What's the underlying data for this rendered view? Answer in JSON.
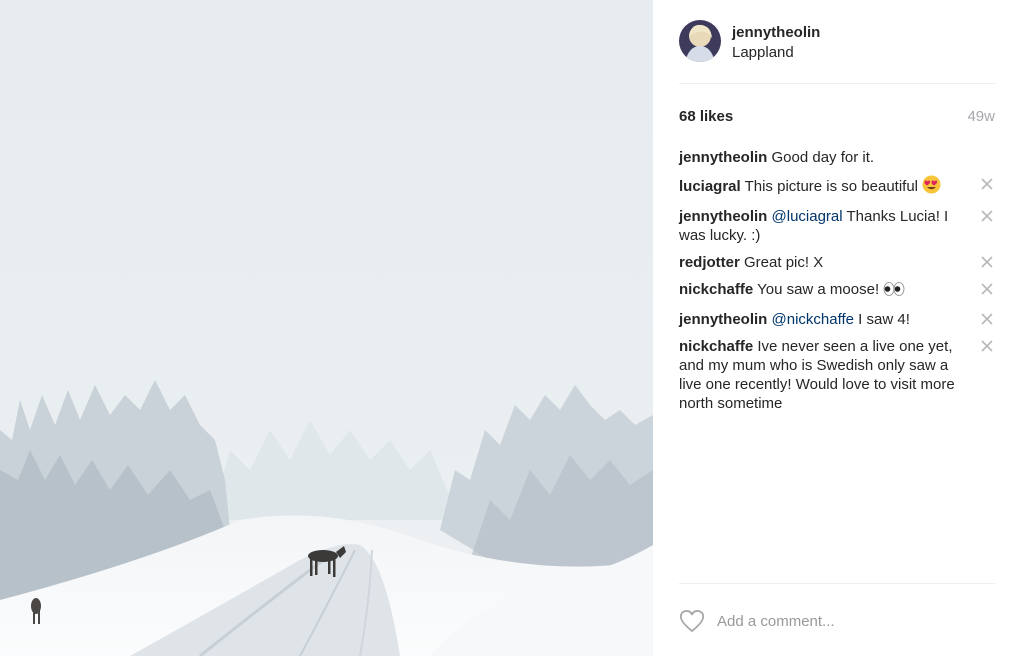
{
  "post": {
    "username": "jennytheolin",
    "location": "Lappland",
    "likes": "68 likes",
    "age": "49w"
  },
  "comments": [
    {
      "author": "jennytheolin",
      "text": " Good day for it."
    },
    {
      "author": "luciagral",
      "text": " This picture is so beautiful "
    },
    {
      "author": "jennytheolin",
      "mention": "@luciagral",
      "text": " Thanks Lucia! I was lucky. :)"
    },
    {
      "author": "redjotter",
      "text": " Great pic! X"
    },
    {
      "author": "nickchaffe",
      "text": " You saw a moose! "
    },
    {
      "author": "jennytheolin",
      "mention": "@nickchaffe",
      "text": " I saw 4!"
    },
    {
      "author": "nickchaffe",
      "text": " Ive never seen a live one yet, and my mum who is Swedish only saw a live one recently! Would love to visit more north sometime"
    }
  ],
  "comment_box": {
    "placeholder": "Add a comment..."
  },
  "icons": {
    "heart": "heart-outline-icon",
    "delete": "close-icon",
    "emoji_heart_eyes": "heart-eyes-emoji-icon",
    "emoji_eyes": "eyes-emoji-icon"
  },
  "colors": {
    "text": "#262626",
    "mention": "#003569",
    "muted": "#a5a7aa",
    "divider": "#efefef"
  }
}
